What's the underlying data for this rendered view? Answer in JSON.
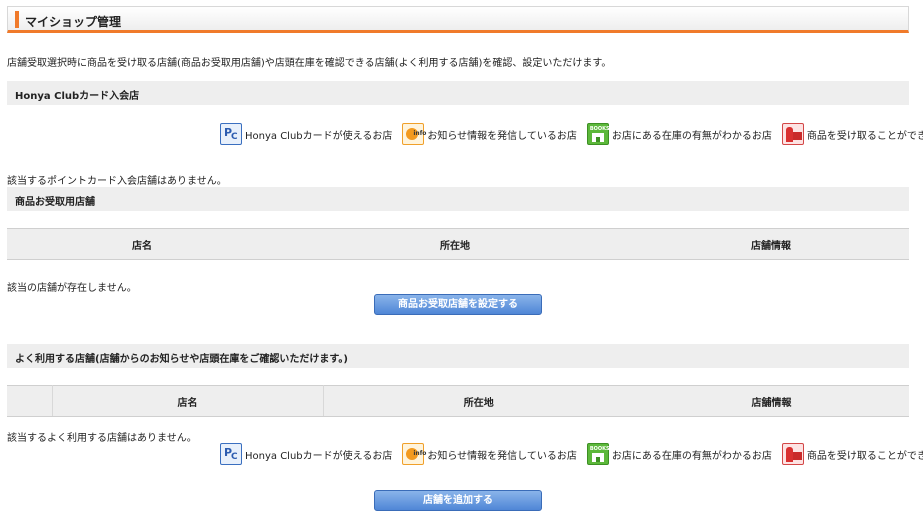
{
  "header": {
    "title": "マイショップ管理"
  },
  "description": "店舗受取選択時に商品を受け取る店舗(商品お受取用店舗)や店頭在庫を確認できる店舗(よく利用する店舗)を確認、設定いただけます。",
  "legend": [
    {
      "icon": "point-card-icon",
      "label": "Honya Clubカードが使えるお店"
    },
    {
      "icon": "info-icon",
      "label": "お知らせ情報を発信しているお店"
    },
    {
      "icon": "books-store-icon",
      "label": "お店にある在庫の有無がわかるお店"
    },
    {
      "icon": "pickup-icon",
      "label": "商品を受け取ることができるお店"
    }
  ],
  "sections": {
    "card_stores": {
      "title": "Honya Clubカード入会店",
      "empty_message": "該当するポイントカード入会店舗はありません。"
    },
    "pickup_stores": {
      "title": "商品お受取用店舗",
      "columns": [
        "店名",
        "所在地",
        "店舗情報"
      ],
      "empty_message": "該当の店舗が存在しません。",
      "button_label": "商品お受取店舗を設定する"
    },
    "frequent_stores": {
      "title": "よく利用する店舗(店舗からのお知らせや店頭在庫をご確認いただけます。)",
      "columns": [
        "",
        "店名",
        "所在地",
        "店舗情報"
      ],
      "empty_message": "該当するよく利用する店舗はありません。",
      "button_label": "店舗を追加する"
    }
  },
  "colors": {
    "accent": "#f07a2a",
    "button": "#4f86d6",
    "section_bg": "#eeeeee"
  }
}
